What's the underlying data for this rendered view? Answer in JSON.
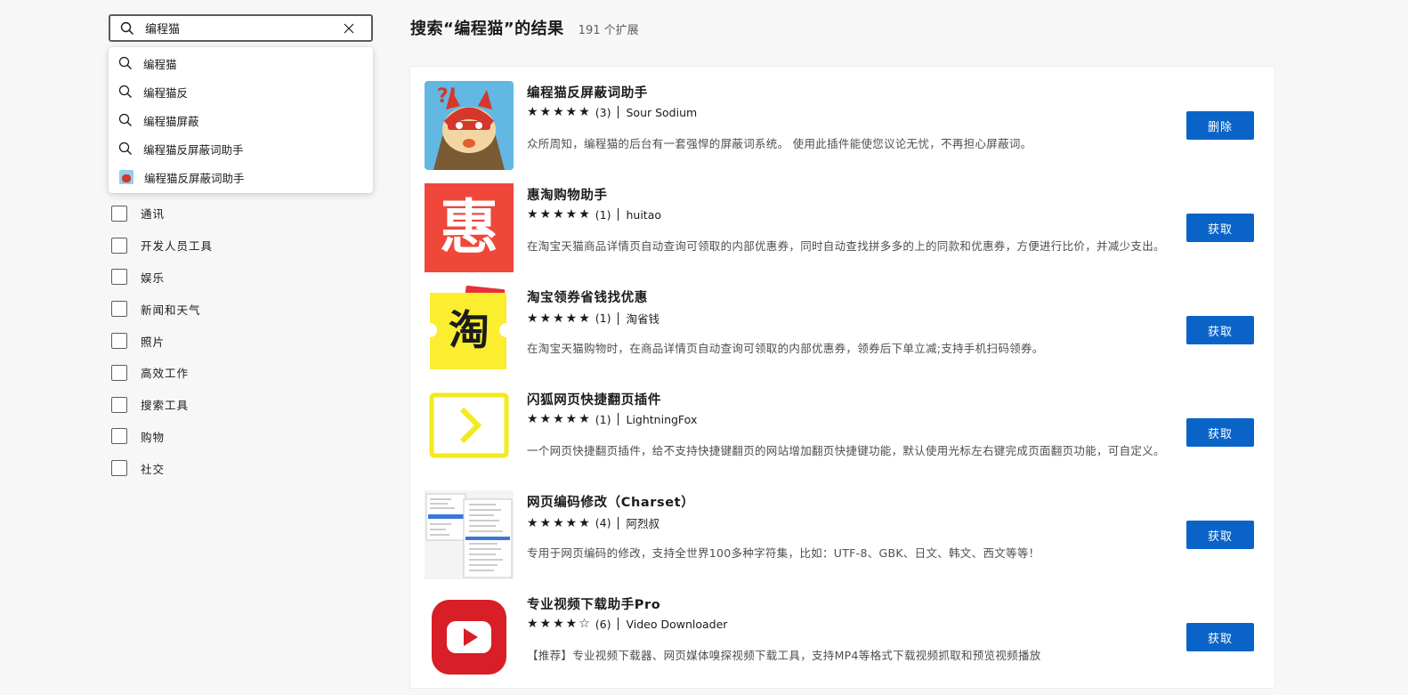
{
  "search": {
    "value": "编程猫",
    "placeholder": ""
  },
  "suggestions": [
    {
      "text": "编程猫"
    },
    {
      "text": "编程猫反"
    },
    {
      "text": "编程猫屏蔽"
    },
    {
      "text": "编程猫反屏蔽词助手"
    },
    {
      "text": "编程猫反屏蔽词助手"
    }
  ],
  "categories": [
    {
      "label": "通讯"
    },
    {
      "label": "开发人员工具"
    },
    {
      "label": "娱乐"
    },
    {
      "label": "新闻和天气"
    },
    {
      "label": "照片"
    },
    {
      "label": "高效工作"
    },
    {
      "label": "搜索工具"
    },
    {
      "label": "购物"
    },
    {
      "label": "社交"
    }
  ],
  "results": {
    "title": "搜索“编程猫”的结果",
    "count": "191 个扩展"
  },
  "extensions": [
    {
      "name": "编程猫反屏蔽词助手",
      "stars": "★★★★★",
      "rating_count": "(3)",
      "author": "Sour Sodium",
      "description": "众所周知，编程猫的后台有一套强悍的屏蔽词系统。 使用此插件能使您议论无忧，不再担心屏蔽词。",
      "button": "删除"
    },
    {
      "name": "惠淘购物助手",
      "stars": "★★★★★",
      "rating_count": "(1)",
      "author": "huitao",
      "description": "在淘宝天猫商品详情页自动查询可领取的内部优惠券，同时自动查找拼多多的上的同款和优惠券，方便进行比价，并减少支出。",
      "button": "获取",
      "logo_text": "惠"
    },
    {
      "name": "淘宝领券省钱找优惠",
      "stars": "★★★★★",
      "rating_count": "(1)",
      "author": "淘省钱",
      "description": "在淘宝天猫购物时，在商品详情页自动查询可领取的内部优惠券，领券后下单立减;支持手机扫码领券。",
      "button": "获取",
      "logo_text": "淘"
    },
    {
      "name": "闪狐网页快捷翻页插件",
      "stars": "★★★★★",
      "rating_count": "(1)",
      "author": "LightningFox",
      "description": "一个网页快捷翻页插件，给不支持快捷键翻页的网站增加翻页快捷键功能，默认使用光标左右键完成页面翻页功能，可自定义。",
      "button": "获取"
    },
    {
      "name": "网页编码修改（Charset）",
      "stars": "★★★★★",
      "rating_count": "(4)",
      "author": "阿烈叔",
      "description": "专用于网页编码的修改，支持全世界100多种字符集，比如：UTF-8、GBK、日文、韩文、西文等等！",
      "button": "获取"
    },
    {
      "name": "专业视频下载助手Pro",
      "stars": "★★★★☆",
      "rating_count": "(6)",
      "author": "Video Downloader",
      "description": "【推荐】专业视频下载器、网页媒体嗅探视频下载工具，支持MP4等格式下载视频抓取和预览视频播放",
      "button": "获取"
    }
  ]
}
